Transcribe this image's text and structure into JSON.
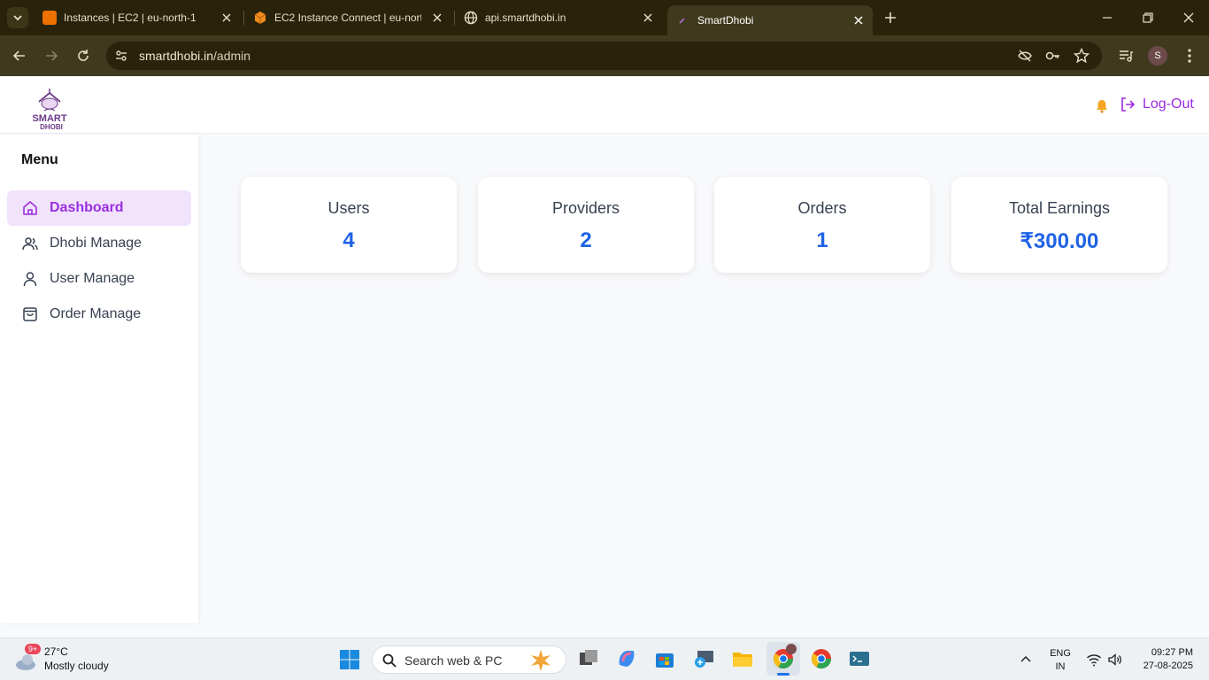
{
  "browser": {
    "tabs": [
      {
        "title": "Instances | EC2 | eu-north-1",
        "active": false
      },
      {
        "title": "EC2 Instance Connect | eu-north-1",
        "active": false
      },
      {
        "title": "api.smartdhobi.in",
        "active": false
      },
      {
        "title": "SmartDhobi",
        "active": true
      }
    ],
    "url_main": "smartdhobi.in",
    "url_path": "/admin",
    "profile_initial": "S"
  },
  "header": {
    "logo_text": "SMART DHOBI",
    "logout_label": "Log-Out"
  },
  "sidebar": {
    "title": "Menu",
    "items": [
      {
        "label": "Dashboard",
        "icon": "home-icon",
        "active": true
      },
      {
        "label": "Dhobi Manage",
        "icon": "users-icon",
        "active": false
      },
      {
        "label": "User Manage",
        "icon": "user-icon",
        "active": false
      },
      {
        "label": "Order Manage",
        "icon": "shopping-bag-icon",
        "active": false
      }
    ]
  },
  "stats": [
    {
      "label": "Users",
      "value": "4"
    },
    {
      "label": "Providers",
      "value": "2"
    },
    {
      "label": "Orders",
      "value": "1"
    },
    {
      "label": "Total Earnings",
      "value": "₹300.00"
    }
  ],
  "taskbar": {
    "weather_badge": "9+",
    "temperature": "27°C",
    "condition": "Mostly cloudy",
    "search_placeholder": "Search web & PC",
    "language_top": "ENG",
    "language_bottom": "IN",
    "time": "09:27 PM",
    "date": "27-08-2025"
  },
  "colors": {
    "accent_purple": "#9a2fe0",
    "stat_blue": "#1e63e6",
    "chrome_bg": "#2a230b"
  }
}
